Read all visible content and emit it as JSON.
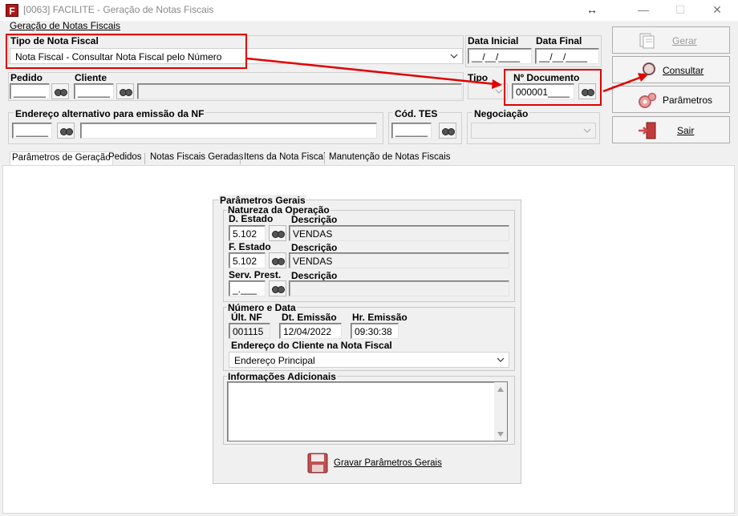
{
  "window": {
    "title": "[0063] FACILITE - Geração de Notas Fiscais",
    "app_icon_letter": "F",
    "resize_glyph": "↔",
    "minimize_glyph": "—",
    "maximize_glyph": "☐",
    "close_glyph": "✕"
  },
  "form": {
    "section_title": "Geração de Notas Fiscais",
    "tipo_nota": {
      "label": "Tipo de Nota Fiscal",
      "value": "Nota Fiscal - Consultar Nota Fiscal pelo Número"
    },
    "data_inicial": {
      "label": "Data Inicial",
      "value": "__/__/____"
    },
    "data_final": {
      "label": "Data Final",
      "value": "__/__/____"
    },
    "pedido": {
      "label": "Pedido",
      "value": "______"
    },
    "cliente": {
      "label": "Cliente",
      "value": "______",
      "name_value": ""
    },
    "tipo": {
      "label": "Tipo",
      "value": ""
    },
    "num_documento": {
      "label": "Nº Documento",
      "value": "000001____"
    },
    "endereco_alt": {
      "label": "Endereço alternativo para emissão da NF",
      "value": "______",
      "desc_value": ""
    },
    "cod_tes": {
      "label": "Cód. TES",
      "value": "______"
    },
    "negociacao": {
      "label": "Negociação",
      "value": ""
    }
  },
  "buttons": {
    "gerar": "Gerar",
    "consultar": "Consultar",
    "parametros": "Parâmetros",
    "sair": "Sair"
  },
  "tabs": [
    "Parâmetros de Geração",
    "Pedidos",
    "Notas Fiscais Geradas",
    "Itens da Nota Fiscal",
    "Manutenção de Notas Fiscais"
  ],
  "params": {
    "group_title": "Parâmetros Gerais",
    "natureza": {
      "title": "Natureza da Operação",
      "d_estado_label": "D. Estado",
      "d_estado_value": "5.102",
      "d_estado_desc_label": "Descrição",
      "d_estado_desc": "VENDAS",
      "f_estado_label": "F. Estado",
      "f_estado_value": "5.102",
      "f_estado_desc_label": "Descrição",
      "f_estado_desc": "VENDAS",
      "serv_label": "Serv. Prest.",
      "serv_value": "_.___",
      "serv_desc_label": "Descrição",
      "serv_desc": ""
    },
    "numero_data": {
      "title": "Número e Data",
      "ult_nf_label": "Últ. NF",
      "ult_nf_value": "001115",
      "dt_emissao_label": "Dt. Emissão",
      "dt_emissao_value": "12/04/2022",
      "hr_emissao_label": "Hr. Emissão",
      "hr_emissao_value": "09:30:38",
      "endereco_label": "Endereço do Cliente na Nota Fiscal",
      "endereco_value": "Endereço Principal"
    },
    "info_adicionais": {
      "title": "Informações Adicionais",
      "value": ""
    },
    "gravar_label": "Gravar Parâmetros Gerais"
  },
  "colors": {
    "highlight_red": "#e00000",
    "window_bg": "#f0f0f0"
  }
}
